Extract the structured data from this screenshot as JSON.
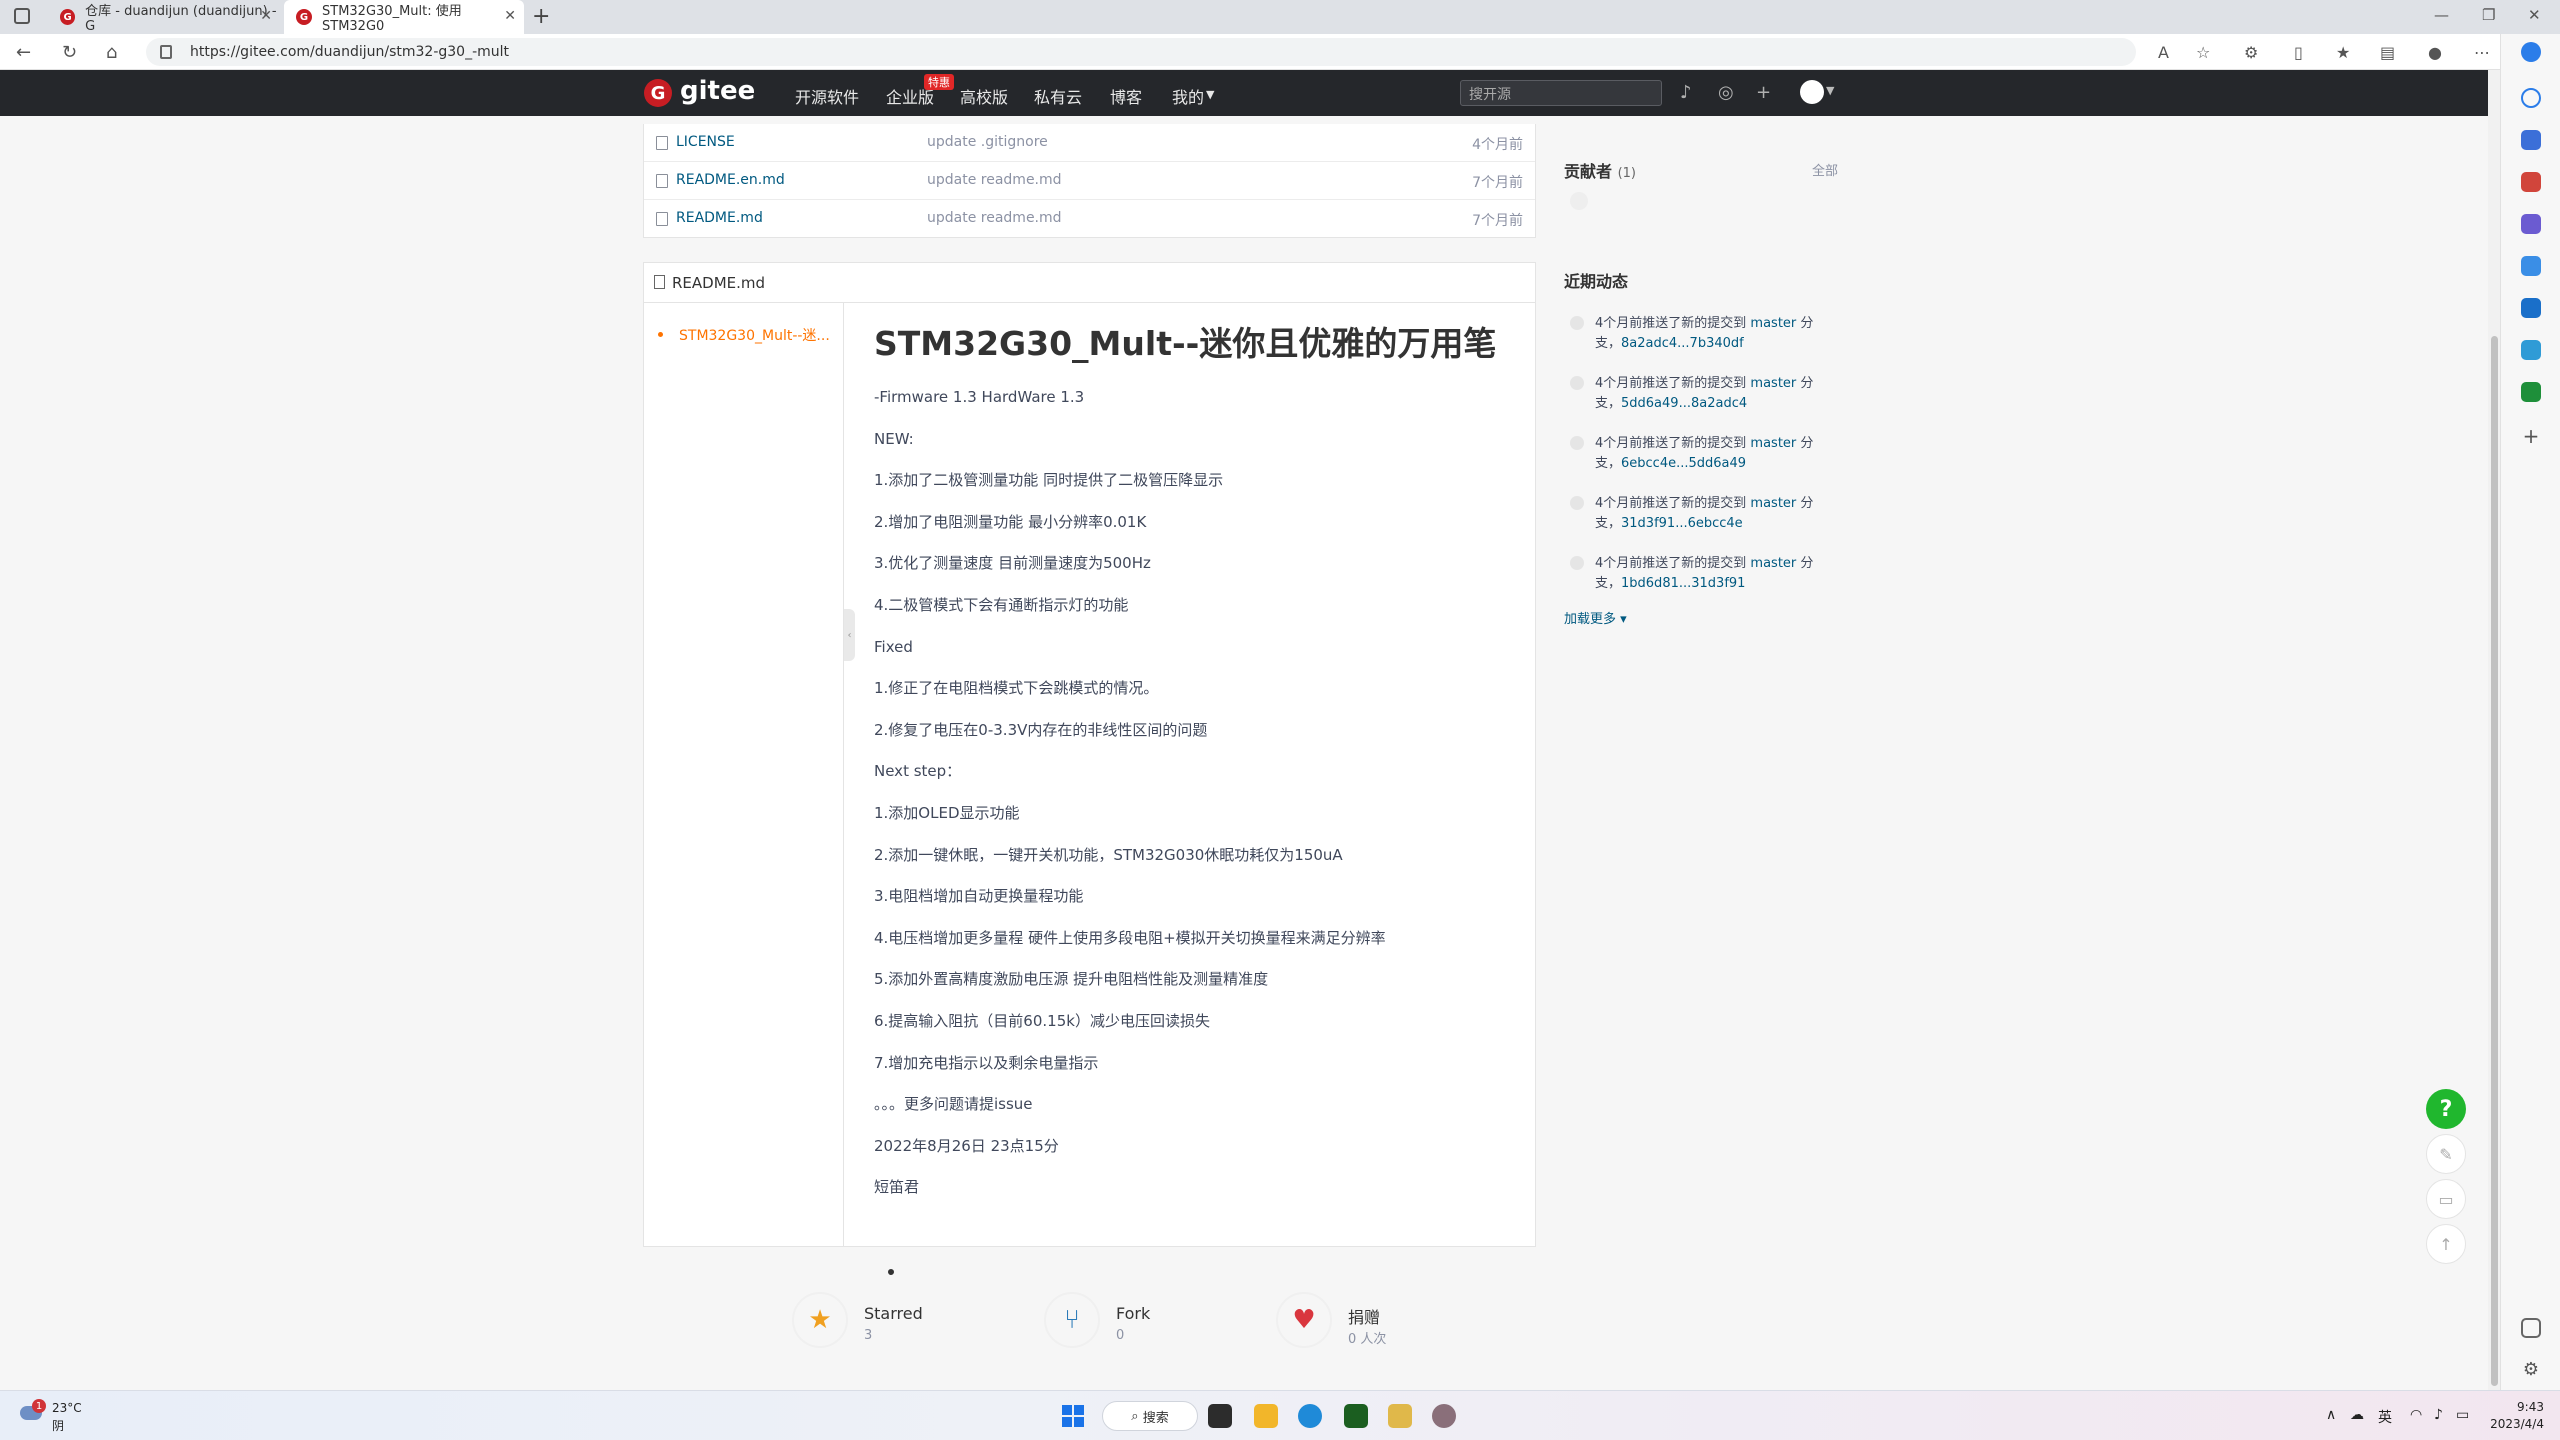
{
  "tabs": [
    {
      "title": "仓库 - duandijun (duandijun) - G",
      "icon": "gitee-favicon"
    },
    {
      "title": "STM32G30_Mult: 使用STM32G0",
      "icon": "gitee-favicon",
      "active": true
    }
  ],
  "address": {
    "url": "https://gitee.com/duandijun/stm32-g30_-mult"
  },
  "header": {
    "logo": "gitee",
    "nav": [
      "开源软件",
      "企业版",
      "高校版",
      "私有云",
      "博客",
      "我的"
    ],
    "badge": "特惠",
    "search_placeholder": "搜开源"
  },
  "files": [
    {
      "name": "LICENSE",
      "commit": "update .gitignore",
      "time": "4个月前"
    },
    {
      "name": "README.en.md",
      "commit": "update readme.md",
      "time": "7个月前"
    },
    {
      "name": "README.md",
      "commit": "update readme.md",
      "time": "7个月前"
    }
  ],
  "readme": {
    "filename": "README.md",
    "toc": "STM32G30_Mult--迷...",
    "title": "STM32G30_Mult--迷你且优雅的万用笔",
    "lines": [
      "-Firmware 1.3 HardWare 1.3",
      "NEW:",
      "1.添加了二极管测量功能 同时提供了二极管压降显示",
      "2.增加了电阻测量功能 最小分辨率0.01K",
      "3.优化了测量速度 目前测量速度为500Hz",
      "4.二极管模式下会有通断指示灯的功能",
      "Fixed",
      "1.修正了在电阻档模式下会跳模式的情况。",
      "2.修复了电压在0-3.3V内存在的非线性区间的问题",
      "Next step：",
      "1.添加OLED显示功能",
      "2.添加一键休眠，一键开关机功能，STM32G030休眠功耗仅为150uA",
      "3.电阻档增加自动更换量程功能",
      "4.电压档增加更多量程 硬件上使用多段电阻+模拟开关切换量程来满足分辨率",
      "5.添加外置高精度激励电压源 提升电阻档性能及测量精准度",
      "6.提高输入阻抗（目前60.15k）减少电压回读损失",
      "7.增加充电指示以及剩余电量指示",
      "。。。更多问题请提issue",
      "2022年8月26日 23点15分",
      "短笛君"
    ]
  },
  "stats": [
    {
      "label": "Starred",
      "count": "3"
    },
    {
      "label": "Fork",
      "count": "0"
    },
    {
      "label": "捐赠",
      "count": "0 人次"
    }
  ],
  "sidebar": {
    "contributors_title": "贡献者",
    "contributors_count": "(1)",
    "contributors_all": "全部",
    "activity_title": "近期动态",
    "activities": [
      {
        "text": "4个月前推送了新的提交到",
        "branch": "master",
        "suffix": "分",
        "prefix2": "支，",
        "range": "8a2adc4...7b340df"
      },
      {
        "text": "4个月前推送了新的提交到",
        "branch": "master",
        "suffix": "分",
        "prefix2": "支，",
        "range": "5dd6a49...8a2adc4"
      },
      {
        "text": "4个月前推送了新的提交到",
        "branch": "master",
        "suffix": "分",
        "prefix2": "支，",
        "range": "6ebcc4e...5dd6a49"
      },
      {
        "text": "4个月前推送了新的提交到",
        "branch": "master",
        "suffix": "分",
        "prefix2": "支，",
        "range": "31d3f91...6ebcc4e"
      },
      {
        "text": "4个月前推送了新的提交到",
        "branch": "master",
        "suffix": "分",
        "prefix2": "支，",
        "range": "1bd6d81...31d3f91"
      }
    ],
    "load_more": "加载更多 ▾"
  },
  "taskbar": {
    "weather_temp": "23°C",
    "weather_desc": "阴",
    "weather_badge": "1",
    "search_label": "搜索",
    "ime": "英",
    "time": "9:43",
    "date": "2023/4/4"
  },
  "colors": {
    "gitee_red": "#c71d23",
    "link": "#005980",
    "toc_active": "#fe7300",
    "help": "#20b72e"
  }
}
